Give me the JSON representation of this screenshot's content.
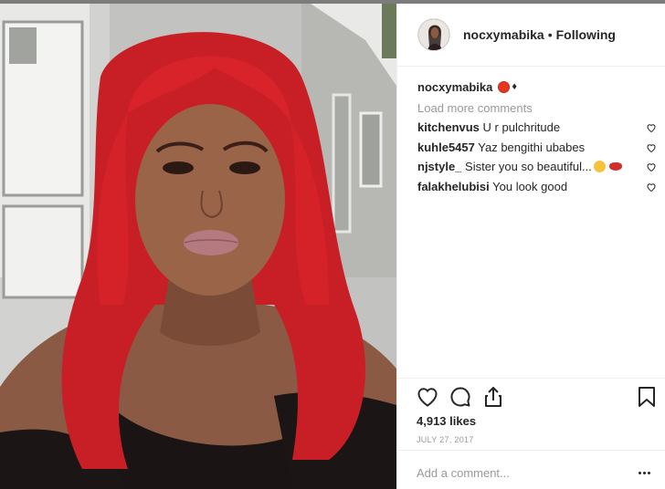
{
  "post": {
    "username": "nocxymabika",
    "separator": "•",
    "follow_status": "Following"
  },
  "caption": {
    "username": "nocxymabika",
    "emoji_1": "red-circle-emoji",
    "emoji_2": "♦"
  },
  "load_more": "Load more comments",
  "comments": [
    {
      "username": "kitchenvus",
      "text": "U r pulchritude",
      "emoji": []
    },
    {
      "username": "kuhle5457",
      "text": "Yaz bengithi ubabes",
      "emoji": []
    },
    {
      "username": "njstyle_",
      "text": "Sister you so beautiful...",
      "emoji": [
        "smiling-face-emoji",
        "kiss-lips-emoji"
      ]
    },
    {
      "username": "falakhelubisi",
      "text": "You look good",
      "emoji": []
    }
  ],
  "actions": {
    "like_icon": "heart-icon",
    "comment_icon": "comment-bubble-icon",
    "share_icon": "share-icon",
    "save_icon": "bookmark-icon"
  },
  "likes": "4,913 likes",
  "date": "JULY 27, 2017",
  "add_comment": {
    "placeholder": "Add a comment..."
  },
  "more_icon": "more-options-icon",
  "colors": {
    "hair": "#d8232a",
    "text": "#262626",
    "muted": "#999999",
    "border": "#efefef"
  }
}
